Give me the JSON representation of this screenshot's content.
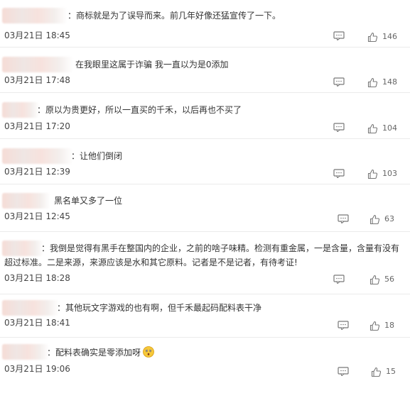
{
  "comments": [
    {
      "text": "商标就是为了误导而来。前几年好像还猛宣传了一下。",
      "time": "03月21日 18:45",
      "likes": "146"
    },
    {
      "text": "在我眼里这属于诈骗 我一直以为是0添加",
      "time": "03月21日 17:48",
      "likes": "148"
    },
    {
      "text": "原以为贵更好，所以一直买的千禾，以后再也不买了",
      "time": "03月21日 17:20",
      "likes": "104"
    },
    {
      "text": "让他们倒闭",
      "time": "03月21日 12:39",
      "likes": "103"
    },
    {
      "text": "黑名单又多了一位",
      "time": "03月21日 12:45",
      "likes": "63"
    },
    {
      "text_line1": "我倒是觉得有黑手在整国内的企业，之前的啥子味精。检测有重金属，一是含量，含量有没有",
      "text_line2": "超过标准。二是来源，来源应该是水和其它原料。记者是不是记者，有待考证!",
      "time": "03月21日 18:28",
      "likes": "56"
    },
    {
      "text": "其他玩文字游戏的也有啊，但千禾最起码配料表干净",
      "time": "03月21日 18:41",
      "likes": "18"
    },
    {
      "text": "配料表确实是零添加呀",
      "time": "03月21日 19:06",
      "likes": "15"
    }
  ],
  "icons": {
    "comment": "comment-bubble-icon",
    "like": "thumbs-up-icon",
    "emoji": "surprised-face-emoji"
  }
}
